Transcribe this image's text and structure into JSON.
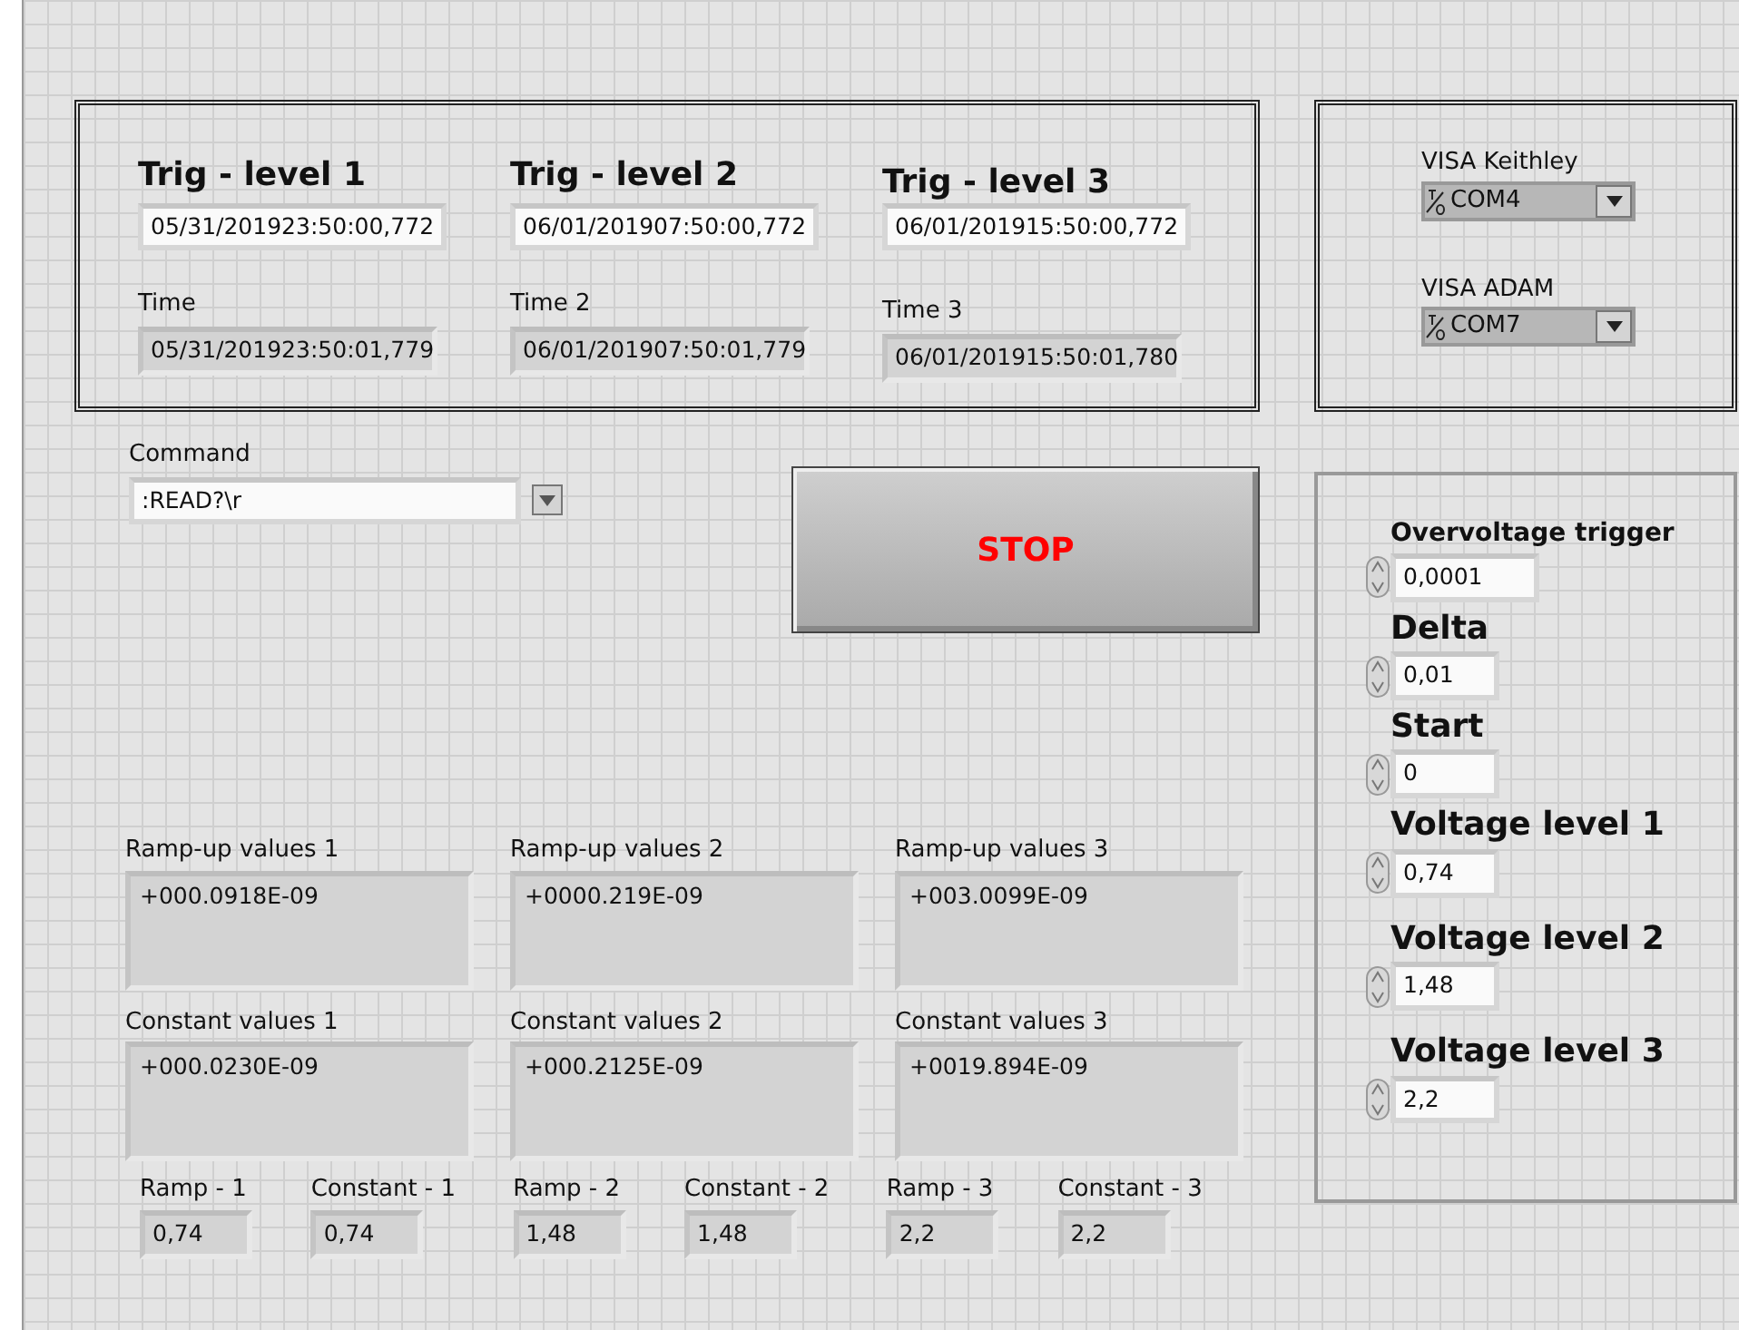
{
  "triggers": [
    {
      "title": "Trig - level 1",
      "value": "05/31/201923:50:00,772",
      "time_label": "Time",
      "time_value": "05/31/201923:50:01,779"
    },
    {
      "title": "Trig - level 2",
      "value": "06/01/201907:50:00,772",
      "time_label": "Time 2",
      "time_value": "06/01/201907:50:01,779"
    },
    {
      "title": "Trig - level 3",
      "value": "06/01/201915:50:00,772",
      "time_label": "Time 3",
      "time_value": "06/01/201915:50:01,780"
    }
  ],
  "visa": [
    {
      "label": "VISA Keithley",
      "value": "COM4"
    },
    {
      "label": "VISA ADAM",
      "value": "COM7"
    }
  ],
  "command": {
    "label": "Command",
    "value": ":READ?\\r"
  },
  "stop_button": {
    "label": "STOP"
  },
  "ramp_up_values": [
    {
      "label": "Ramp-up values 1",
      "value": "+000.0918E-09"
    },
    {
      "label": "Ramp-up values 2",
      "value": "+0000.219E-09"
    },
    {
      "label": "Ramp-up values 3",
      "value": "+003.0099E-09"
    }
  ],
  "constant_values": [
    {
      "label": "Constant values 1",
      "value": "+000.0230E-09"
    },
    {
      "label": "Constant values 2",
      "value": "+000.2125E-09"
    },
    {
      "label": "Constant values 3",
      "value": "+0019.894E-09"
    }
  ],
  "indicators": [
    {
      "label": "Ramp - 1",
      "value": "0,74"
    },
    {
      "label": "Constant - 1",
      "value": "0,74"
    },
    {
      "label": "Ramp - 2",
      "value": "1,48"
    },
    {
      "label": "Constant - 2",
      "value": "1,48"
    },
    {
      "label": "Ramp - 3",
      "value": "2,2"
    },
    {
      "label": "Constant - 3",
      "value": "2,2"
    }
  ],
  "parameters": [
    {
      "label": "Overvoltage trigger",
      "value": "0,0001"
    },
    {
      "label": "Delta",
      "value": "0,01"
    },
    {
      "label": "Start",
      "value": "0"
    },
    {
      "label": "Voltage level  1",
      "value": "0,74"
    },
    {
      "label": "Voltage level 2",
      "value": "1,48"
    },
    {
      "label": "Voltage level 3",
      "value": "2,2"
    }
  ]
}
